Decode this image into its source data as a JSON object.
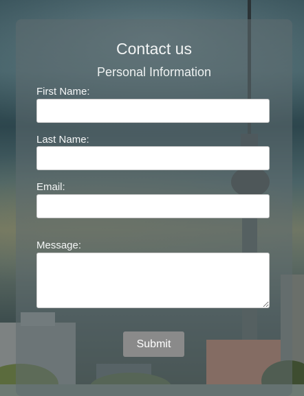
{
  "form": {
    "title": "Contact us",
    "subtitle": "Personal Information",
    "first_name_label": "First Name:",
    "first_name_value": "",
    "last_name_label": "Last Name:",
    "last_name_value": "",
    "email_label": "Email:",
    "email_value": "",
    "message_label": "Message:",
    "message_value": "",
    "submit_label": "Submit"
  },
  "colors": {
    "card_overlay": "#5f6c70",
    "submit_background": "#8a8a8a",
    "text": "#f5f7f7"
  },
  "icons": {
    "resize_handle": "textarea-resize-icon"
  }
}
